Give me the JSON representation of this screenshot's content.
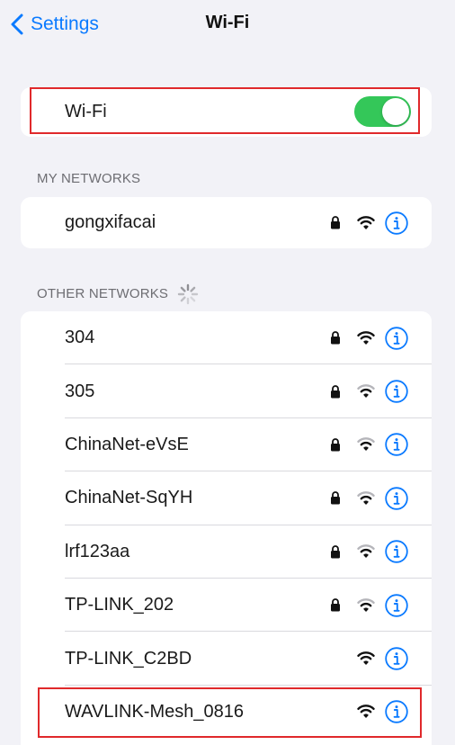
{
  "nav": {
    "back_label": "Settings",
    "title": "Wi-Fi"
  },
  "wifi": {
    "label": "Wi-Fi",
    "enabled": true,
    "toggle_color": "#34c759"
  },
  "my_networks": {
    "header": "MY NETWORKS",
    "items": [
      {
        "name": "gongxifacai",
        "secured": true,
        "signal": "full"
      }
    ]
  },
  "other_networks": {
    "header": "OTHER NETWORKS",
    "scanning": true,
    "items": [
      {
        "name": "304",
        "secured": true,
        "signal": "full"
      },
      {
        "name": "305",
        "secured": true,
        "signal": "medium"
      },
      {
        "name": "ChinaNet-eVsE",
        "secured": true,
        "signal": "medium"
      },
      {
        "name": "ChinaNet-SqYH",
        "secured": true,
        "signal": "medium"
      },
      {
        "name": "lrf123aa",
        "secured": true,
        "signal": "medium"
      },
      {
        "name": "TP-LINK_202",
        "secured": true,
        "signal": "medium"
      },
      {
        "name": "TP-LINK_C2BD",
        "secured": false,
        "signal": "full"
      },
      {
        "name": "WAVLINK-Mesh_0816",
        "secured": false,
        "signal": "full"
      }
    ]
  },
  "colors": {
    "accent": "#0a7aff",
    "highlight": "#e0292b",
    "background": "#f2f2f7"
  },
  "icons": {
    "back": "chevron-left-icon",
    "lock": "lock-icon",
    "wifi": "wifi-icon",
    "info": "info-icon",
    "spinner": "spinner-icon"
  }
}
